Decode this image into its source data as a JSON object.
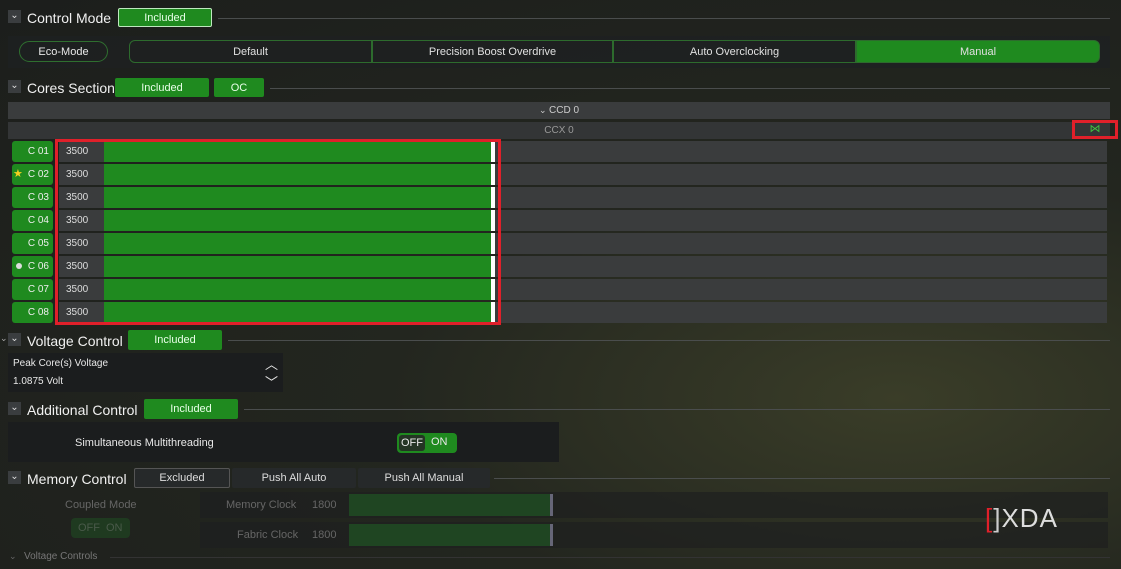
{
  "control_mode": {
    "title": "Control Mode",
    "status": "Included",
    "eco": "Eco-Mode",
    "modes": [
      "Default",
      "Precision Boost Overdrive",
      "Auto Overclocking",
      "Manual"
    ],
    "selected": "Manual"
  },
  "cores": {
    "title": "Cores Section",
    "status": "Included",
    "oc": "OC",
    "ccd": "CCD 0",
    "ccx": "CCX 0",
    "items": [
      {
        "label": "C 01",
        "value": "3500",
        "mark": ""
      },
      {
        "label": "C 02",
        "value": "3500",
        "mark": "star"
      },
      {
        "label": "C 03",
        "value": "3500",
        "mark": ""
      },
      {
        "label": "C 04",
        "value": "3500",
        "mark": ""
      },
      {
        "label": "C 05",
        "value": "3500",
        "mark": ""
      },
      {
        "label": "C 06",
        "value": "3500",
        "mark": "dot"
      },
      {
        "label": "C 07",
        "value": "3500",
        "mark": ""
      },
      {
        "label": "C 08",
        "value": "3500",
        "mark": ""
      }
    ]
  },
  "voltage": {
    "title": "Voltage Control",
    "status": "Included",
    "label": "Peak Core(s) Voltage",
    "value": "1.0875 Volt"
  },
  "additional": {
    "title": "Additional Control",
    "status": "Included",
    "smt": "Simultaneous Multithreading",
    "off": "OFF",
    "on": "ON"
  },
  "memory": {
    "title": "Memory Control",
    "status": "Excluded",
    "push_auto": "Push All Auto",
    "push_manual": "Push All Manual",
    "coupled": "Coupled Mode",
    "off": "OFF",
    "on": "ON",
    "mem_clock": "Memory Clock",
    "mem_value": "1800",
    "fabric_clock": "Fabric Clock",
    "fabric_value": "1800",
    "voltage_controls": "Voltage Controls"
  },
  "watermark": "XDA",
  "colors": {
    "accent": "#1f8a1f",
    "highlight": "#e0202a"
  }
}
